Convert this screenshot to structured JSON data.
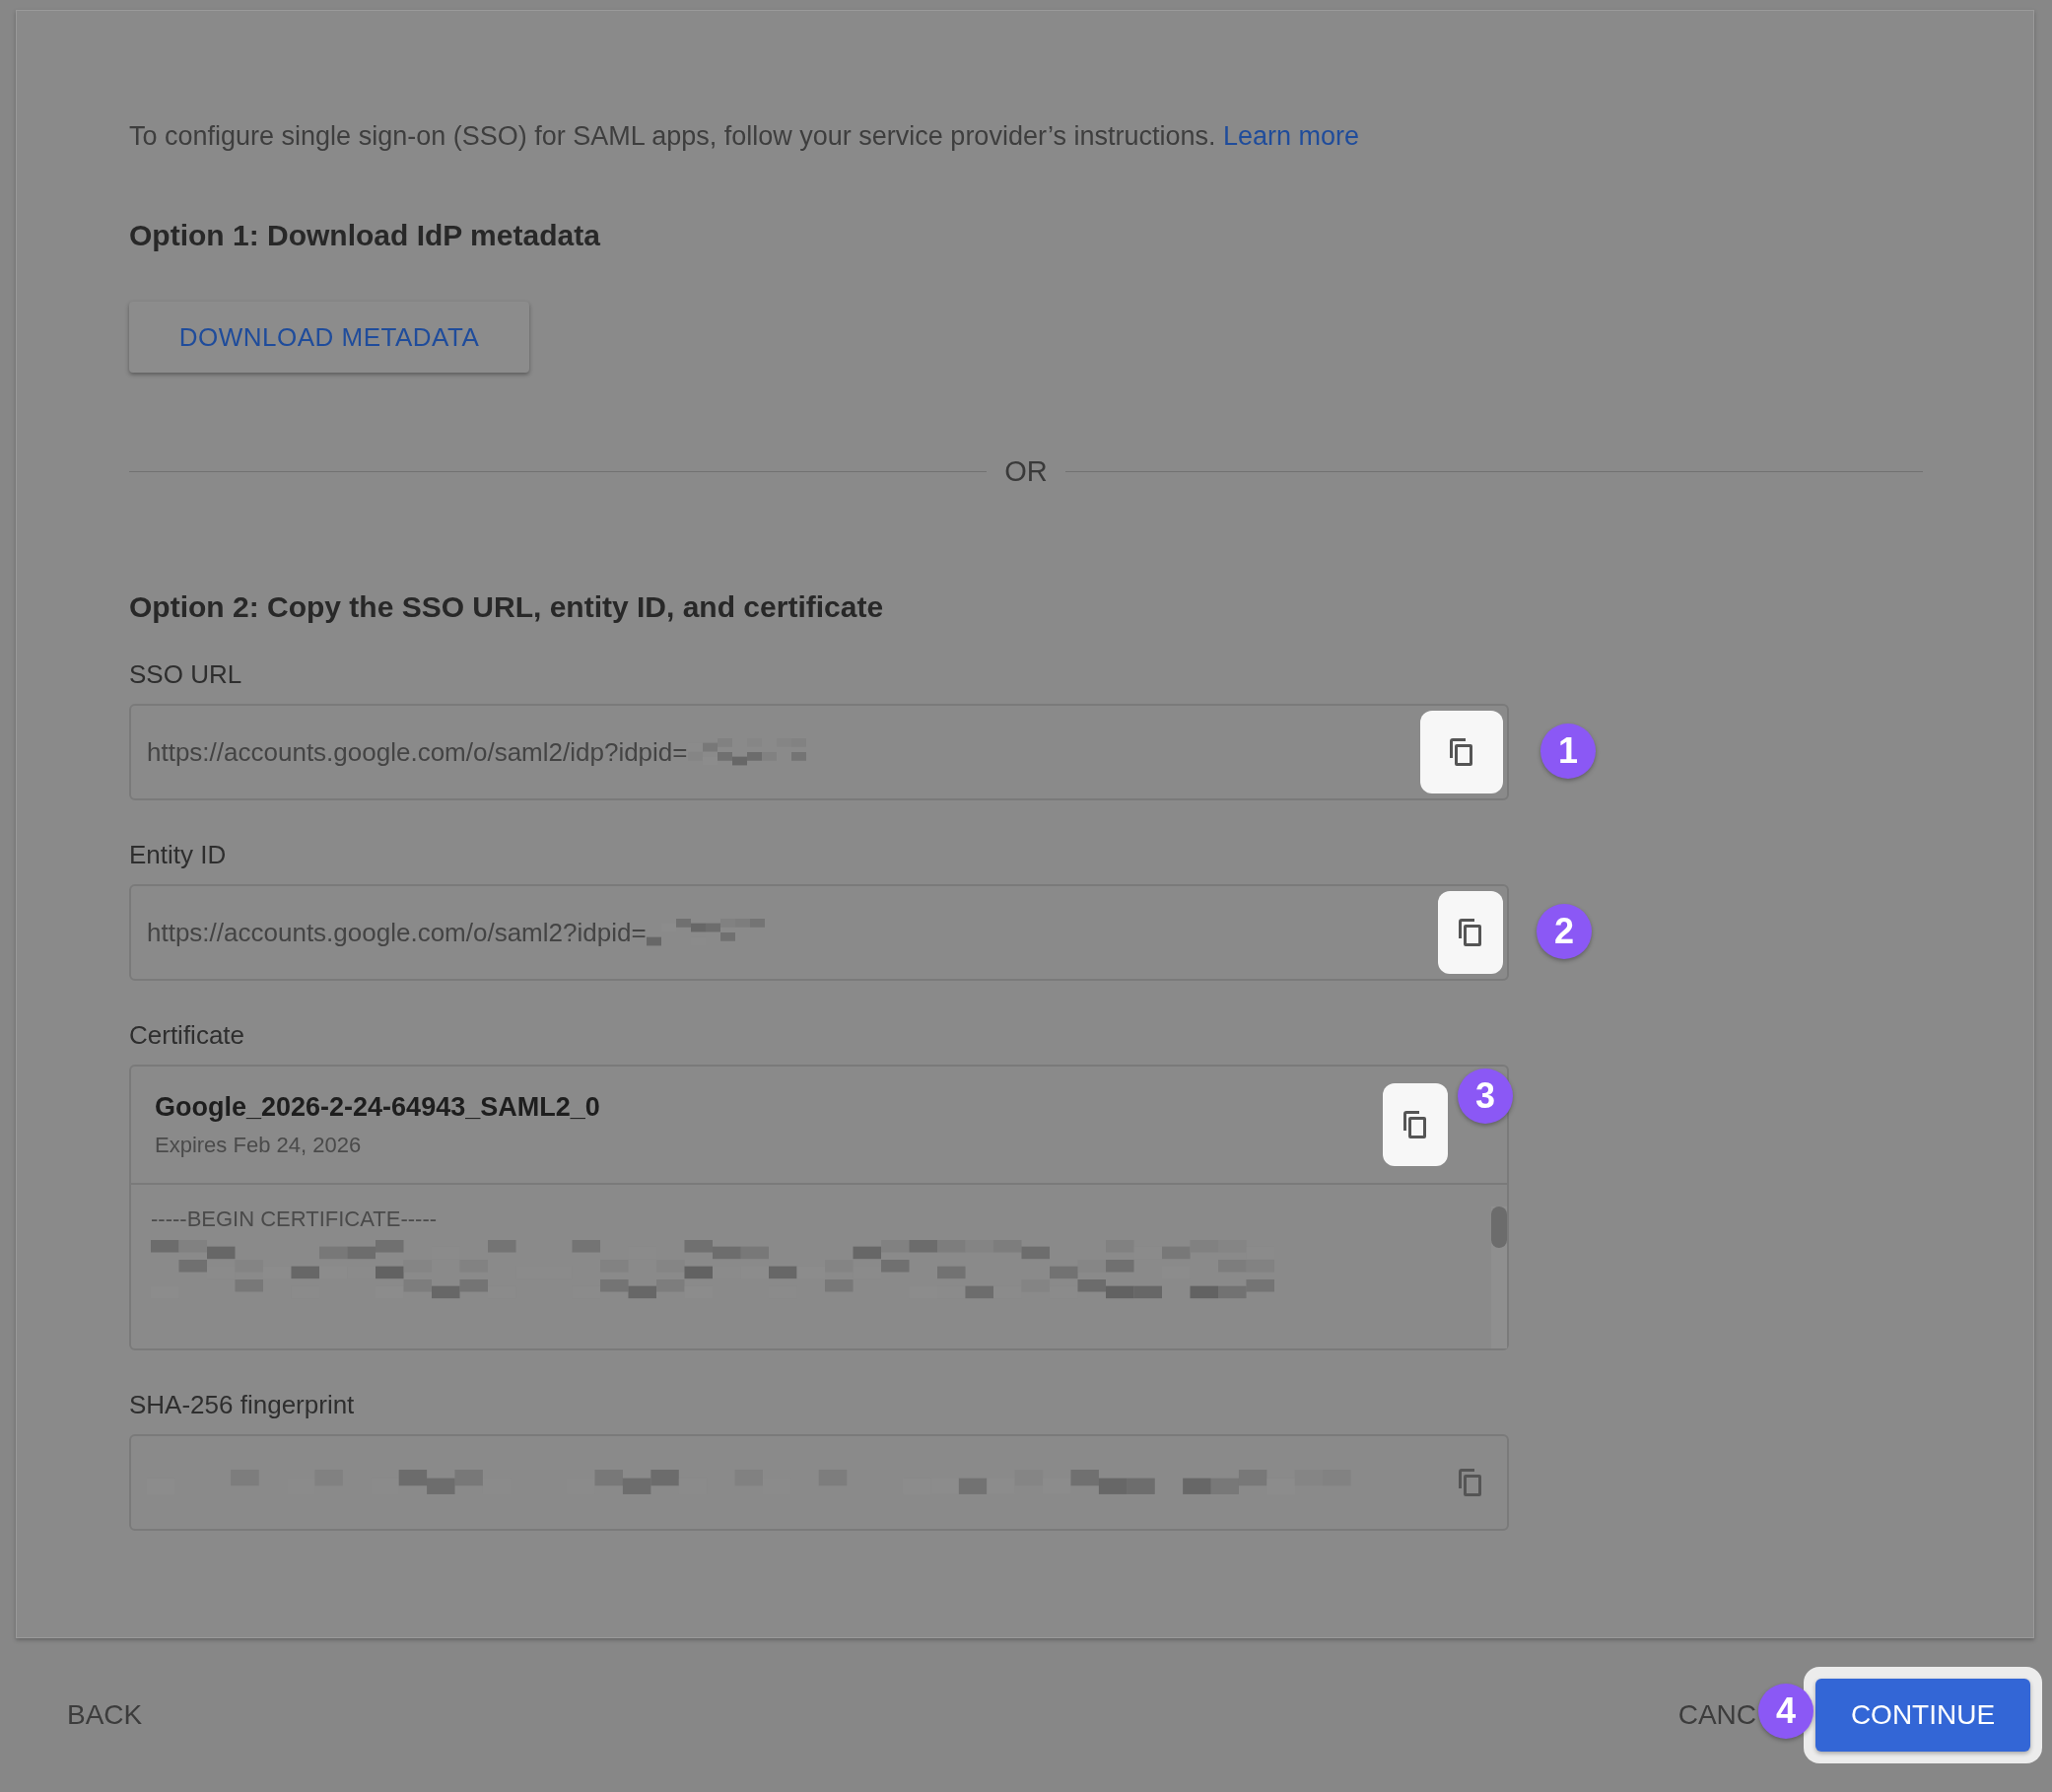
{
  "intro": {
    "text": "To configure single sign-on (SSO) for SAML apps, follow your service provider’s instructions.",
    "link": "Learn more"
  },
  "option1": {
    "heading": "Option 1: Download IdP metadata",
    "button": "DOWNLOAD METADATA"
  },
  "divider": "OR",
  "option2": {
    "heading": "Option 2: Copy the SSO URL, entity ID, and certificate"
  },
  "fields": [
    {
      "kind": "url",
      "label": "SSO URL",
      "value": "https://accounts.google.com/o/saml2/idp?idpid=",
      "copy_highlighted": true,
      "badge": "1"
    },
    {
      "kind": "url",
      "label": "Entity ID",
      "value": "https://accounts.google.com/o/saml2?idpid=",
      "copy_highlighted": true,
      "badge": "2"
    },
    {
      "kind": "certificate",
      "label": "Certificate",
      "name": "Google_2026-2-24-64943_SAML2_0",
      "expires": "Expires Feb 24, 2026",
      "body": "-----BEGIN CERTIFICATE-----",
      "copy_highlighted": true,
      "badge": "3"
    },
    {
      "kind": "fingerprint",
      "label": "SHA-256 fingerprint",
      "copy_highlighted": false
    }
  ],
  "footer": {
    "back": "BACK",
    "cancel": "CANC",
    "cancel_badge": "4",
    "continue": "CONTINUE",
    "continue_highlighted": true
  }
}
